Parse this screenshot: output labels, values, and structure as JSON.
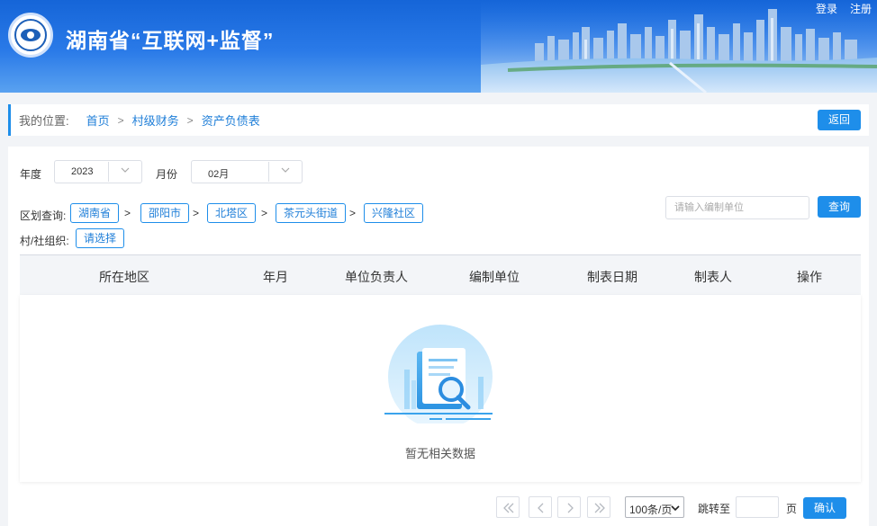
{
  "header": {
    "title": "湖南省“互联网+监督”",
    "login": "登录",
    "register": "注册"
  },
  "breadcrumb": {
    "label": "我的位置:",
    "items": [
      "首页",
      "村级财务",
      "资产负债表"
    ],
    "separator": ">",
    "back_label": "返回"
  },
  "filters": {
    "year_label": "年度",
    "year_value": "2023",
    "month_label": "月份",
    "month_value": "02月",
    "region_label": "区划查询:",
    "region_path": [
      "湖南省",
      "邵阳市",
      "北塔区",
      "茶元头街道",
      "兴隆社区"
    ],
    "region_separator": ">",
    "org_label": "村/社组织:",
    "org_placeholder": "请选择",
    "search_placeholder": "请输入编制单位",
    "query_label": "查询"
  },
  "table": {
    "columns": [
      "所在地区",
      "年月",
      "单位负责人",
      "编制单位",
      "制表日期",
      "制表人",
      "操作"
    ],
    "rows": [],
    "empty_text": "暂无相关数据"
  },
  "pagination": {
    "page_size": "100条/页",
    "jump_label": "跳转至",
    "page_unit": "页",
    "confirm_label": "确认"
  },
  "colors": {
    "primary": "#1e8eea",
    "header_blue": "#1565d8"
  }
}
